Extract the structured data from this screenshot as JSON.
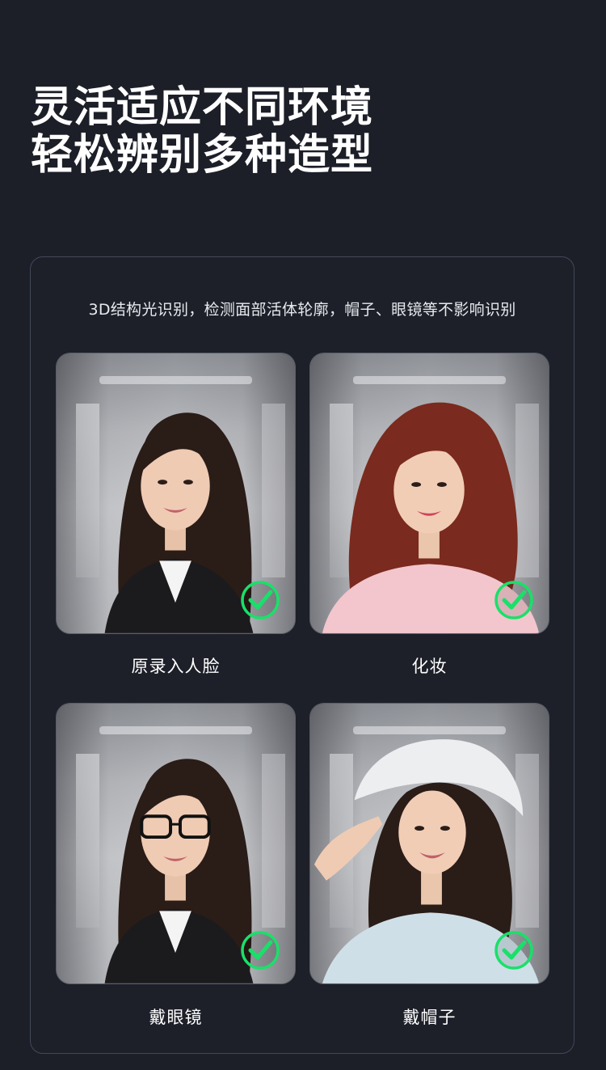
{
  "headline": {
    "line1": "灵活适应不同环境",
    "line2": "轻松辨别多种造型"
  },
  "panel": {
    "description": "3D结构光识别，检测面部活体轮廓，帽子、眼镜等不影响识别"
  },
  "cards": [
    {
      "caption": "原录入人脸",
      "status_icon": "check-circle-icon"
    },
    {
      "caption": "化妆",
      "status_icon": "check-circle-icon"
    },
    {
      "caption": "戴眼镜",
      "status_icon": "check-circle-icon"
    },
    {
      "caption": "戴帽子",
      "status_icon": "check-circle-icon"
    }
  ],
  "colors": {
    "background": "#1c1f28",
    "panel_border": "#434859",
    "check_green": "#19e06a"
  }
}
